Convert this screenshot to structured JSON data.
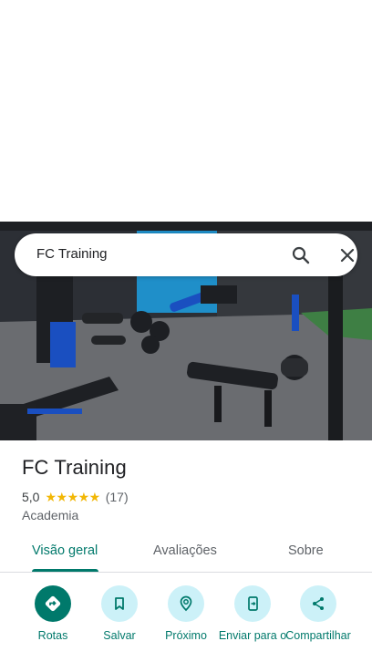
{
  "search": {
    "query": "FC Training"
  },
  "place": {
    "name": "FC Training",
    "rating": "5,0",
    "stars": "★★★★★",
    "review_count": "(17)",
    "category": "Academia"
  },
  "tabs": [
    {
      "label": "Visão geral",
      "active": true
    },
    {
      "label": "Avaliações",
      "active": false
    },
    {
      "label": "Sobre",
      "active": false
    }
  ],
  "actions": [
    {
      "label": "Rotas",
      "icon": "directions-icon"
    },
    {
      "label": "Salvar",
      "icon": "bookmark-icon"
    },
    {
      "label": "Próximo",
      "icon": "nearby-icon"
    },
    {
      "label": "Enviar para o",
      "icon": "send-to-phone-icon"
    },
    {
      "label": "Compartilhar",
      "icon": "share-icon"
    }
  ],
  "colors": {
    "accent": "#00796b",
    "chip": "#ccf1f8",
    "star": "#f2b705"
  }
}
